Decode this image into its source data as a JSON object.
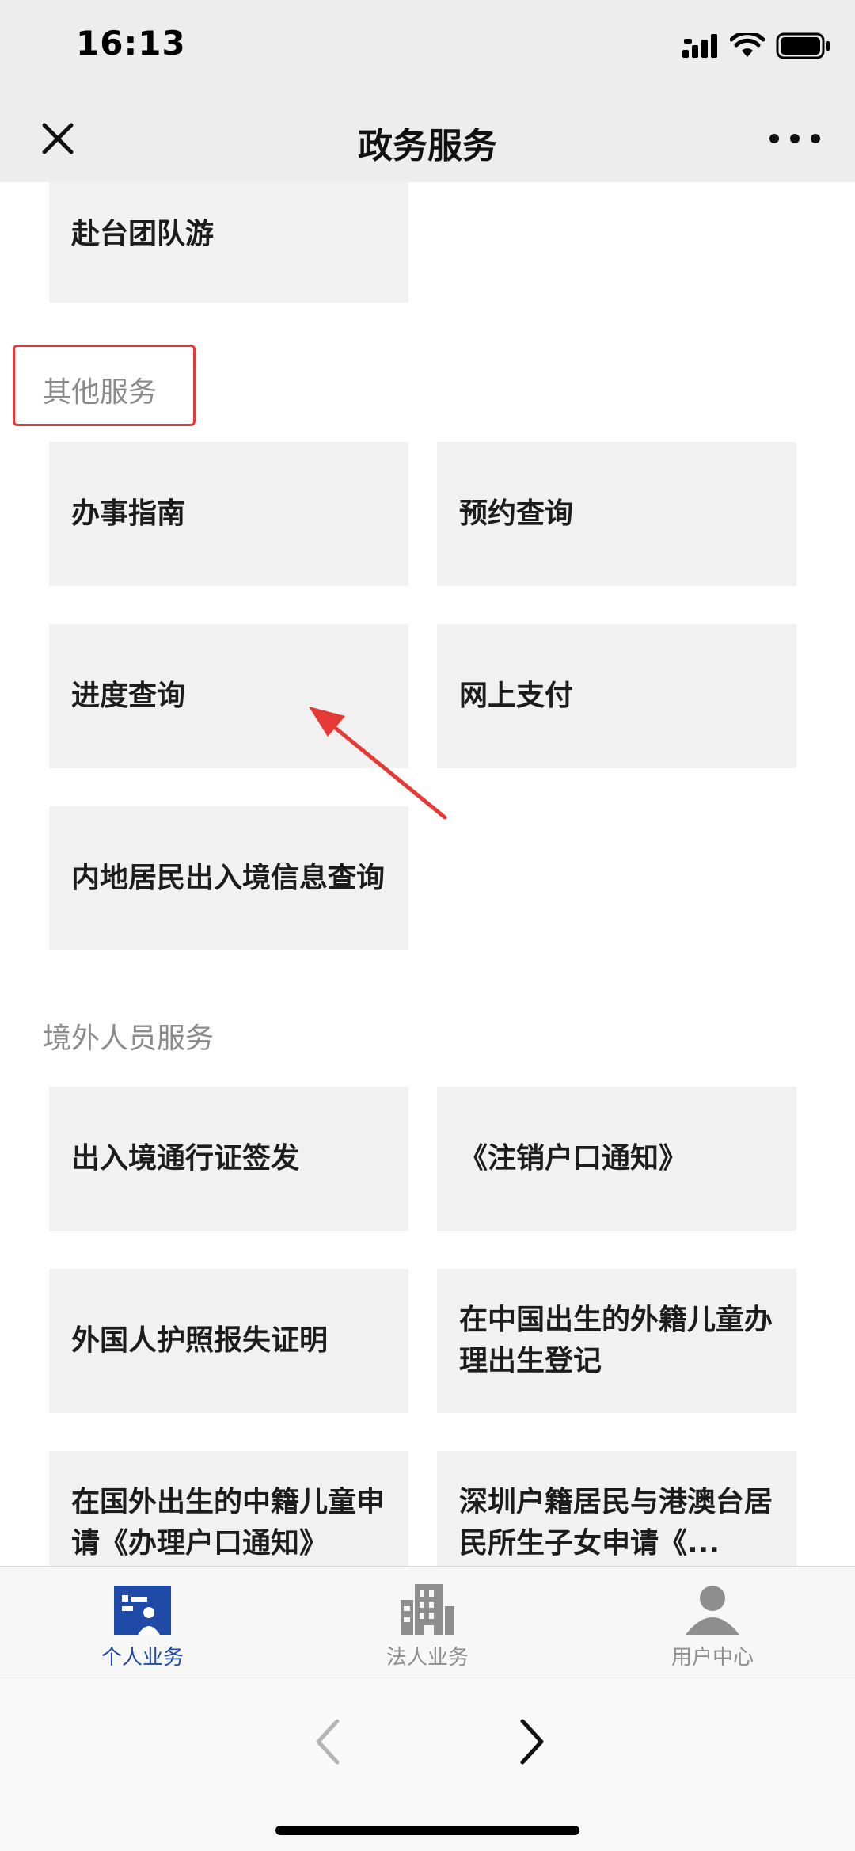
{
  "status": {
    "time": "16:13"
  },
  "nav": {
    "title": "政务服务"
  },
  "top_tile": {
    "label": "赴台团队游"
  },
  "sections": [
    {
      "title": "其他服务",
      "items": [
        "办事指南",
        "预约查询",
        "进度查询",
        "网上支付",
        "内地居民出入境信息查询"
      ]
    },
    {
      "title": "境外人员服务",
      "items": [
        "出入境通行证签发",
        "《注销户口通知》",
        "外国人护照报失证明",
        "在中国出生的外籍儿童办理出生登记",
        "在国外出生的中籍儿童申请《办理户口通知》",
        "深圳户籍居民与港澳台居民所生子女申请《..."
      ]
    }
  ],
  "tabs": [
    {
      "label": "个人业务",
      "icon": "personal-business-icon",
      "active": true
    },
    {
      "label": "法人业务",
      "icon": "building-icon",
      "active": false
    },
    {
      "label": "用户中心",
      "icon": "user-icon",
      "active": false
    }
  ],
  "colors": {
    "accent": "#1f4aa8",
    "highlight": "#e53935",
    "tile_bg": "#f1f1f1"
  }
}
